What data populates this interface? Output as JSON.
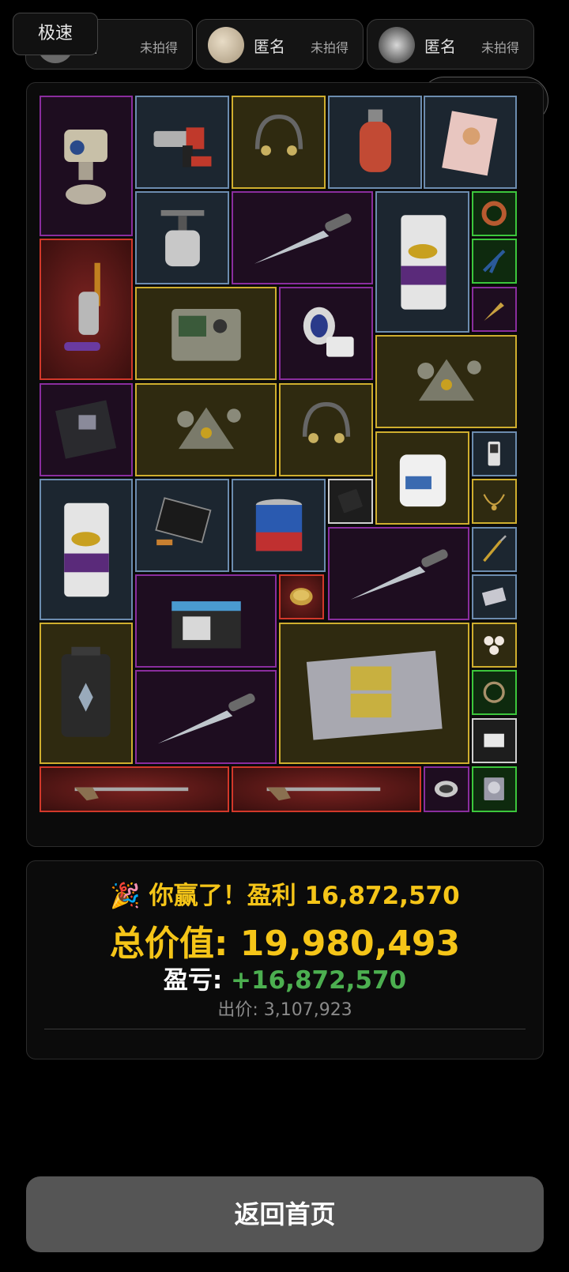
{
  "top": {
    "speed_label": "极速",
    "bidders": [
      {
        "name": "名",
        "status": "未拍得"
      },
      {
        "name": "匿名",
        "status": "未拍得"
      },
      {
        "name": "匿名",
        "status": "未拍得"
      }
    ]
  },
  "grid": {
    "items": [
      {
        "name": "thermal-camera",
        "rarity": "purple"
      },
      {
        "name": "hammer-drill",
        "rarity": "blue"
      },
      {
        "name": "headset",
        "rarity": "gold"
      },
      {
        "name": "gas-cylinder",
        "rarity": "blue"
      },
      {
        "name": "magazine",
        "rarity": "blue"
      },
      {
        "name": "camp-stove",
        "rarity": "blue"
      },
      {
        "name": "combat-knife",
        "rarity": "purple"
      },
      {
        "name": "cement-bag",
        "rarity": "blue"
      },
      {
        "name": "cable-coil",
        "rarity": "green"
      },
      {
        "name": "pliers",
        "rarity": "green"
      },
      {
        "name": "vacuum-cleaner",
        "rarity": "red"
      },
      {
        "name": "radio-station",
        "rarity": "gold"
      },
      {
        "name": "blood-pressure-monitor",
        "rarity": "purple"
      },
      {
        "name": "small-knife",
        "rarity": "purple"
      },
      {
        "name": "triangle-keychain",
        "rarity": "gold"
      },
      {
        "name": "motherboard",
        "rarity": "purple"
      },
      {
        "name": "triangle-keychain",
        "rarity": "gold"
      },
      {
        "name": "headset",
        "rarity": "gold"
      },
      {
        "name": "jerrycan",
        "rarity": "gold"
      },
      {
        "name": "mp3-player",
        "rarity": "blue"
      },
      {
        "name": "cement-bag",
        "rarity": "blue"
      },
      {
        "name": "lcd-screen",
        "rarity": "blue"
      },
      {
        "name": "paint-can",
        "rarity": "blue"
      },
      {
        "name": "screwdriver-set",
        "rarity": "white"
      },
      {
        "name": "jewel-necklace",
        "rarity": "gold"
      },
      {
        "name": "ornate-knife",
        "rarity": "purple"
      },
      {
        "name": "drill-bit",
        "rarity": "blue"
      },
      {
        "name": "car-battery",
        "rarity": "purple"
      },
      {
        "name": "caviar-tin",
        "rarity": "red"
      },
      {
        "name": "hard-drive",
        "rarity": "blue"
      },
      {
        "name": "power-station",
        "rarity": "gold"
      },
      {
        "name": "server-rack",
        "rarity": "gold"
      },
      {
        "name": "pearls",
        "rarity": "gold"
      },
      {
        "name": "combat-knife",
        "rarity": "purple"
      },
      {
        "name": "rope",
        "rarity": "green"
      },
      {
        "name": "cloth",
        "rarity": "white"
      },
      {
        "name": "musket",
        "rarity": "red"
      },
      {
        "name": "musket",
        "rarity": "red"
      },
      {
        "name": "pocket-watch",
        "rarity": "purple"
      },
      {
        "name": "hdd-disk",
        "rarity": "green"
      }
    ]
  },
  "result": {
    "emoji": "🎉",
    "win_text": "你赢了！盈利 16,872,570",
    "total_label": "总价值:",
    "total_value": "19,980,493",
    "pl_label": "盈亏:",
    "pl_value": "+16,872,570",
    "bid_text": "出价: 3,107,923"
  },
  "footer": {
    "home_label": "返回首页"
  },
  "colors": {
    "gold": "#f5c518",
    "profit_green": "#4caf50",
    "rarity_purple": "#8a2d9e",
    "rarity_gold": "#cfae2e",
    "rarity_blue": "#6c8caf",
    "rarity_red": "#d2382a",
    "rarity_green": "#3cc63c",
    "rarity_white": "#cfcfcf"
  }
}
